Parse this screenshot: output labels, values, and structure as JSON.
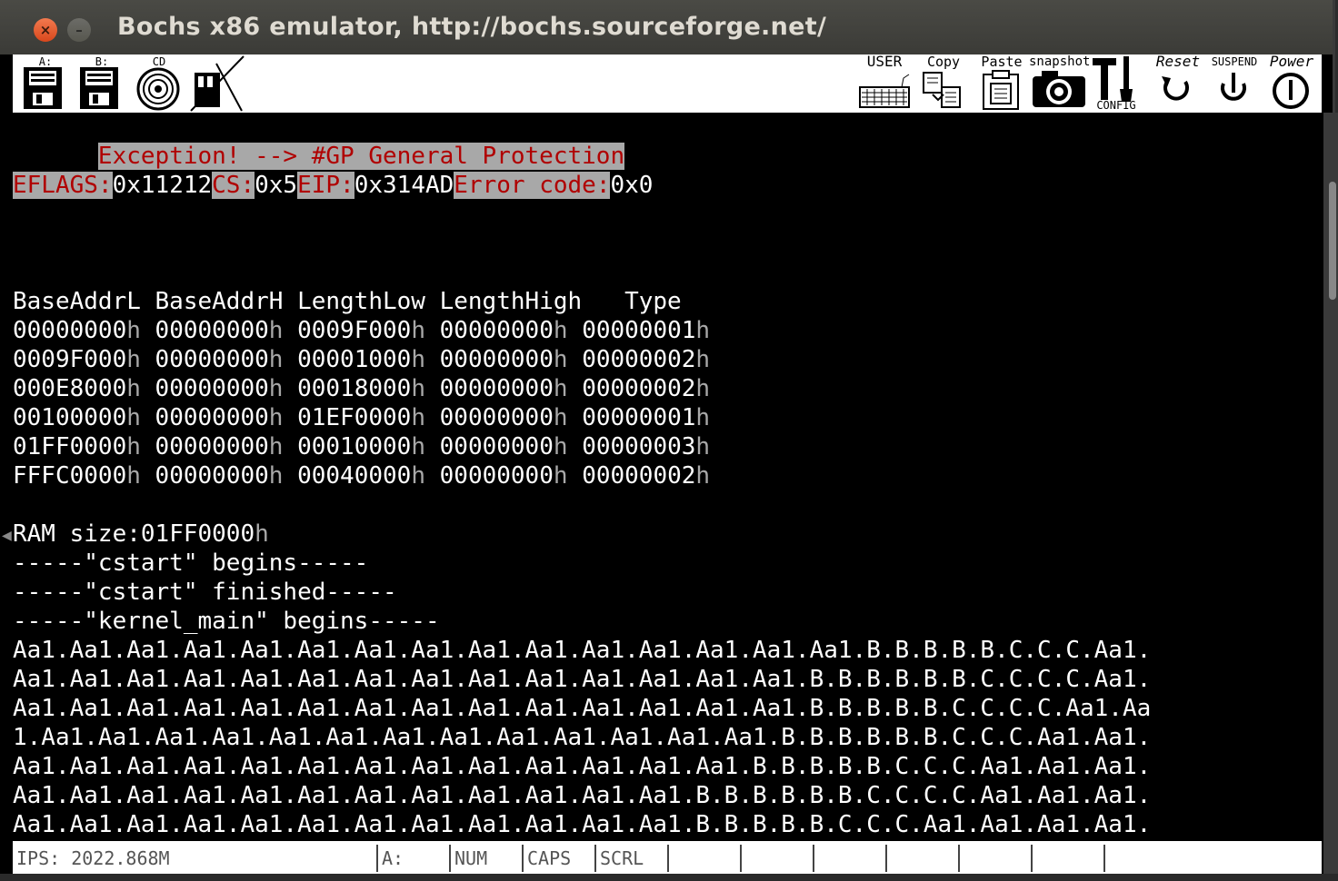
{
  "window": {
    "title": "Bochs x86 emulator, http://bochs.sourceforge.net/",
    "close_label": "×",
    "min_label": "–"
  },
  "toolbar": {
    "drive_a": "A:",
    "drive_b": "B:",
    "cdrom": "CD",
    "user": "USER",
    "copy": "Copy",
    "paste": "Paste",
    "snapshot": "snapshot",
    "config": "CONFIG",
    "reset": "Reset",
    "suspend": "SUSPEND",
    "power": "Power"
  },
  "screen": {
    "exception": "Exception! --> #GP General Protection",
    "regs": {
      "eflags_label": "EFLAGS:",
      "eflags_value": "0x11212",
      "cs_label": "CS:",
      "cs_value": "0x5",
      "eip_label": "EIP:",
      "eip_value": "0x314AD",
      "err_label": "Error code:",
      "err_value": "0x0"
    },
    "memmap_header": "BaseAddrL BaseAddrH LengthLow LengthHigh   Type",
    "memmap_rows": [
      [
        "00000000",
        "00000000",
        "0009F000",
        "00000000",
        "00000001"
      ],
      [
        "0009F000",
        "00000000",
        "00001000",
        "00000000",
        "00000002"
      ],
      [
        "000E8000",
        "00000000",
        "00018000",
        "00000000",
        "00000002"
      ],
      [
        "00100000",
        "00000000",
        "01EF0000",
        "00000000",
        "00000001"
      ],
      [
        "01FF0000",
        "00000000",
        "00010000",
        "00000000",
        "00000003"
      ],
      [
        "FFFC0000",
        "00000000",
        "00040000",
        "00000000",
        "00000002"
      ]
    ],
    "hex_suffix": "h",
    "ram_label": "RAM size:",
    "ram_value": "01FF0000",
    "log_lines": [
      "-----\"cstart\" begins-----",
      "-----\"cstart\" finished-----",
      "-----\"kernel_main\" begins-----"
    ],
    "output_lines": [
      "Aa1.Aa1.Aa1.Aa1.Aa1.Aa1.Aa1.Aa1.Aa1.Aa1.Aa1.Aa1.Aa1.Aa1.Aa1.B.B.B.B.B.C.C.C.Aa1.",
      "Aa1.Aa1.Aa1.Aa1.Aa1.Aa1.Aa1.Aa1.Aa1.Aa1.Aa1.Aa1.Aa1.Aa1.B.B.B.B.B.B.C.C.C.C.Aa1.",
      "Aa1.Aa1.Aa1.Aa1.Aa1.Aa1.Aa1.Aa1.Aa1.Aa1.Aa1.Aa1.Aa1.Aa1.B.B.B.B.B.C.C.C.C.Aa1.Aa",
      "1.Aa1.Aa1.Aa1.Aa1.Aa1.Aa1.Aa1.Aa1.Aa1.Aa1.Aa1.Aa1.Aa1.B.B.B.B.B.B.C.C.C.Aa1.Aa1.",
      "Aa1.Aa1.Aa1.Aa1.Aa1.Aa1.Aa1.Aa1.Aa1.Aa1.Aa1.Aa1.Aa1.B.B.B.B.B.C.C.C.Aa1.Aa1.Aa1.",
      "Aa1.Aa1.Aa1.Aa1.Aa1.Aa1.Aa1.Aa1.Aa1.Aa1.Aa1.Aa1.B.B.B.B.B.B.C.C.C.C.Aa1.Aa1.Aa1.",
      "Aa1.Aa1.Aa1.Aa1.Aa1.Aa1.Aa1.Aa1.Aa1.Aa1.Aa1.Aa1.B.B.B.B.B.C.C.C.Aa1.Aa1.Aa1.Aa1."
    ]
  },
  "statusbar": {
    "ips": "IPS: 2022.868M",
    "drive": "A:",
    "num": "NUM",
    "caps": "CAPS",
    "scrl": "SCRL"
  },
  "colors": {
    "exception_fg": "#b00000",
    "label_bg": "#a8a8a8"
  },
  "icons": [
    "floppy-a-icon",
    "floppy-b-icon",
    "cdrom-icon",
    "sound-icon",
    "keyboard-icon",
    "copy-icon",
    "paste-icon",
    "snapshot-icon",
    "config-icon",
    "reset-icon",
    "suspend-icon",
    "power-icon"
  ]
}
